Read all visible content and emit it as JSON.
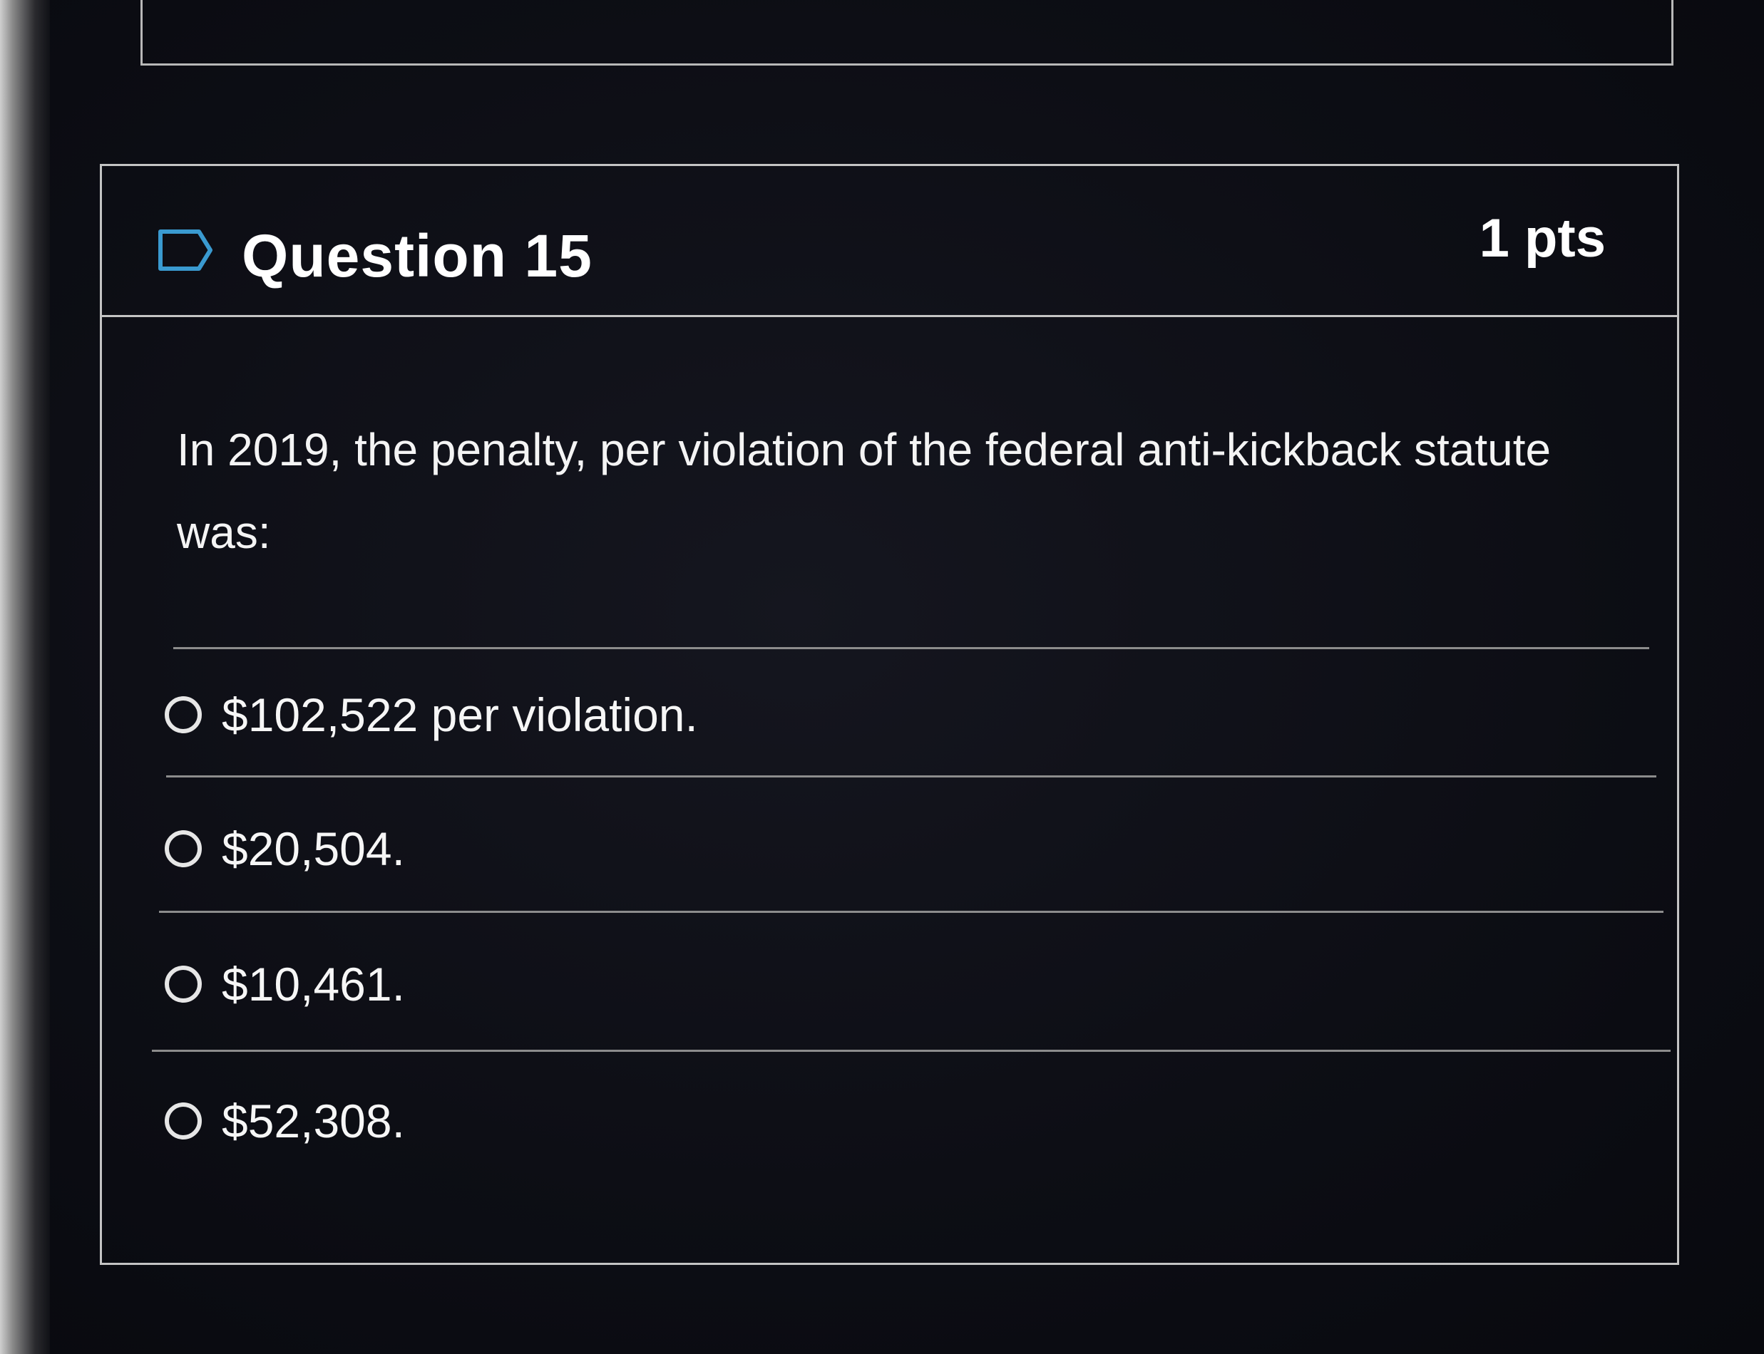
{
  "question": {
    "title": "Question 15",
    "points": "1 pts",
    "text": "In 2019, the penalty, per violation of the federal anti-kickback statute was:"
  },
  "answers": [
    {
      "label": "$102,522 per violation.",
      "selected": false
    },
    {
      "label": "$20,504.",
      "selected": false
    },
    {
      "label": "$10,461.",
      "selected": false
    },
    {
      "label": "$52,308.",
      "selected": false
    }
  ],
  "colors": {
    "background": "#0e0f16",
    "border": "#c4c4c4",
    "text": "#f2f2f2",
    "flag_icon": "#3a9ad0"
  },
  "icons": {
    "flag": "flag-icon",
    "radio": "radio-unchecked-icon"
  }
}
